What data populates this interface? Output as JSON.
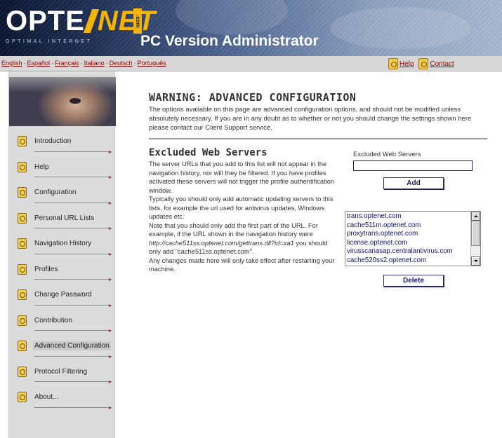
{
  "header": {
    "logo_left": "OPTE",
    "logo_right": "NET",
    "logo_dotcom": ".com",
    "logo_tagline": "OPTIMAL INTERNET",
    "app_title": "PC Version Administrator"
  },
  "languages": [
    "English",
    "Español",
    "Français",
    "Italiano",
    "Deutsch",
    "Português"
  ],
  "top_links": {
    "help_label": "Help",
    "contact_label": "Contact",
    "help_icon": "help-book-icon",
    "contact_icon": "contact-book-icon"
  },
  "sidebar": {
    "items": [
      {
        "label": "Introduction"
      },
      {
        "label": "Help"
      },
      {
        "label": "Configuration"
      },
      {
        "label": "Personal URL Lists"
      },
      {
        "label": "Navigation History"
      },
      {
        "label": "Profiles"
      },
      {
        "label": "Change Password"
      },
      {
        "label": "Contribution"
      },
      {
        "label": "Advanced Configuration",
        "active": true
      },
      {
        "label": "Protocol Filtering"
      },
      {
        "label": "About..."
      }
    ]
  },
  "warning": {
    "title": "WARNING: ADVANCED CONFIGURATION",
    "text": "The options available on this page are advanced configuration options, and should not be modified unless absolutely necessary. If you are in any doubt as to whether or not you should change the settings shown here please contact our Client Support service."
  },
  "excluded": {
    "title": "Excluded Web Servers",
    "desc_1": "The server URLs that you add to this list will not appear in the navigation history, nor will they be filtered. If you have profiles activated these servers will not trigger the profile authentification window.",
    "desc_2": "Typically you should only add automatic updating servers to this lists, for example the url used for antivirus updates, Windows updates etc.",
    "desc_3_pre": "Note that you should only add the first part of the URL. For example, if the URL shown in the navigation history were ",
    "desc_3_url": "http://cache511ss.optenet.com/gettrans.dll?id=xa1",
    "desc_3_post": " you should only add \"cache511ss.optenet.com\".",
    "desc_4": "Any changes made here will only take effect after restarting your machine.",
    "field_label": "Excluded Web Servers",
    "field_value": "",
    "add_label": "Add",
    "delete_label": "Delete",
    "servers": [
      "trans.optenet.com",
      "cache511m.optenet.com",
      "proxytrans.optenet.com",
      "license.optenet.com",
      "virusscanasap.centralantivirus.com",
      "cache520ss2.optenet.com"
    ]
  },
  "colors": {
    "link": "#8b0000",
    "button_text": "#1a1a6e",
    "list_text": "#10106a",
    "sidebar_bg": "#dcdcdc",
    "logo_accent": "#f5b400"
  }
}
